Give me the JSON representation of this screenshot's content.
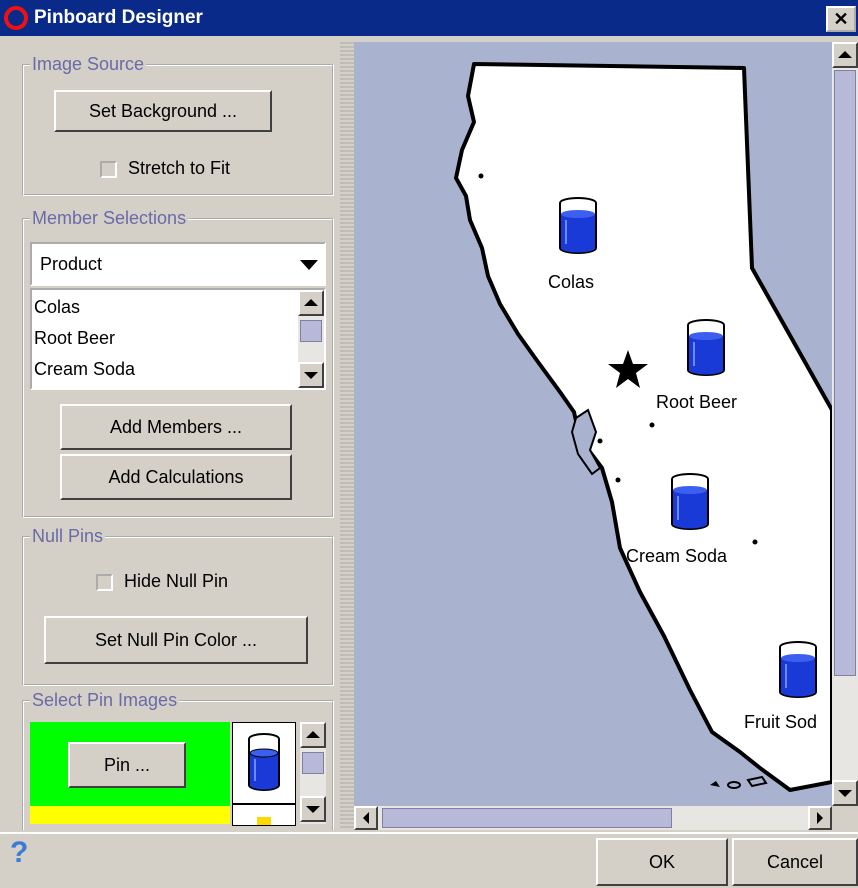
{
  "window": {
    "title": "Pinboard Designer",
    "close_glyph": "✕"
  },
  "image_source": {
    "title": "Image Source",
    "set_background_label": "Set Background ...",
    "stretch_label": "Stretch to Fit",
    "stretch_checked": false
  },
  "member_selections": {
    "title": "Member Selections",
    "dimension": "Product",
    "members": [
      "Colas",
      "Root Beer",
      "Cream Soda"
    ],
    "add_members_label": "Add Members ...",
    "add_calculations_label": "Add Calculations"
  },
  "null_pins": {
    "title": "Null Pins",
    "hide_label": "Hide Null Pin",
    "hide_checked": false,
    "set_color_label": "Set Null Pin Color ..."
  },
  "pin_images": {
    "title": "Select Pin Images",
    "pin_button_label": "Pin ...",
    "colors": {
      "pin1": "#00ff00",
      "pin2": "#ffff00"
    }
  },
  "map": {
    "pins": [
      {
        "label": "Colas"
      },
      {
        "label": "Root Beer"
      },
      {
        "label": "Cream Soda"
      },
      {
        "label": "Fruit Sod"
      }
    ]
  },
  "footer": {
    "ok_label": "OK",
    "cancel_label": "Cancel",
    "help_icon": "?"
  }
}
